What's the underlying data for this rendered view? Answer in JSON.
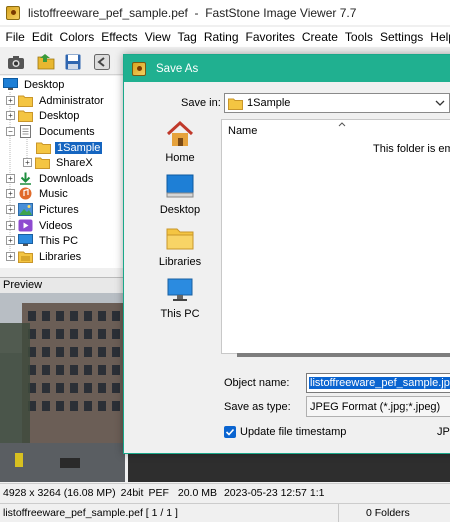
{
  "window": {
    "title": "listoffreeware_pef_sample.pef  -  FastStone Image Viewer 7.7"
  },
  "menu": [
    "File",
    "Edit",
    "Colors",
    "Effects",
    "View",
    "Tag",
    "Rating",
    "Favorites",
    "Create",
    "Tools",
    "Settings",
    "Help"
  ],
  "toolbar": {
    "icons": [
      "camera-icon",
      "open-folder-icon",
      "save-icon",
      "back-icon"
    ]
  },
  "tree": {
    "items": [
      {
        "label": "Desktop",
        "icon": "desktop-icon"
      },
      {
        "label": "Administrator",
        "icon": "folder-icon"
      },
      {
        "label": "Desktop",
        "icon": "folder-icon"
      },
      {
        "label": "Documents",
        "icon": "documents-icon"
      },
      {
        "label": "1Sample",
        "icon": "folder-icon",
        "selected": true
      },
      {
        "label": "ShareX",
        "icon": "folder-icon"
      },
      {
        "label": "Downloads",
        "icon": "downloads-icon"
      },
      {
        "label": "Music",
        "icon": "music-icon"
      },
      {
        "label": "Pictures",
        "icon": "pictures-icon"
      },
      {
        "label": "Videos",
        "icon": "videos-icon"
      },
      {
        "label": "This PC",
        "icon": "this-pc-icon"
      },
      {
        "label": "Libraries",
        "icon": "libraries-icon"
      }
    ]
  },
  "preview": {
    "label": "Preview"
  },
  "info_bar": {
    "dimensions": "4928 x 3264 (16.08 MP)",
    "bitdepth": "24bit",
    "format": "PEF",
    "filesize": "20.0 MB",
    "datetime": "2023-05-23 12:57",
    "zoom": "1:1"
  },
  "status_bar": {
    "filename": "listoffreeware_pef_sample.pef [ 1 / 1 ]",
    "folders": "0 Folders"
  },
  "dialog": {
    "title": "Save As",
    "save_in_label": "Save in:",
    "save_in_value": "1Sample",
    "places": [
      {
        "label": "Home",
        "icon": "home-icon"
      },
      {
        "label": "Desktop",
        "icon": "desktop-icon"
      },
      {
        "label": "Libraries",
        "icon": "libraries-icon"
      },
      {
        "label": "This PC",
        "icon": "this-pc-icon"
      }
    ],
    "column_name": "Name",
    "empty_message": "This folder is emp",
    "object_name_label": "Object name:",
    "object_name_value": "listoffreeware_pef_sample.jpg",
    "save_as_type_label": "Save as type:",
    "save_as_type_value": "JPEG Format (*.jpg;*.jpeg)",
    "update_timestamp_label": "Update file timestamp",
    "update_timestamp_checked": true,
    "jpeg_settings_label": "JPE"
  },
  "colors": {
    "dialog_title_bg": "#20b090",
    "selection": "#1565c0",
    "accent": "#0a64d0"
  }
}
